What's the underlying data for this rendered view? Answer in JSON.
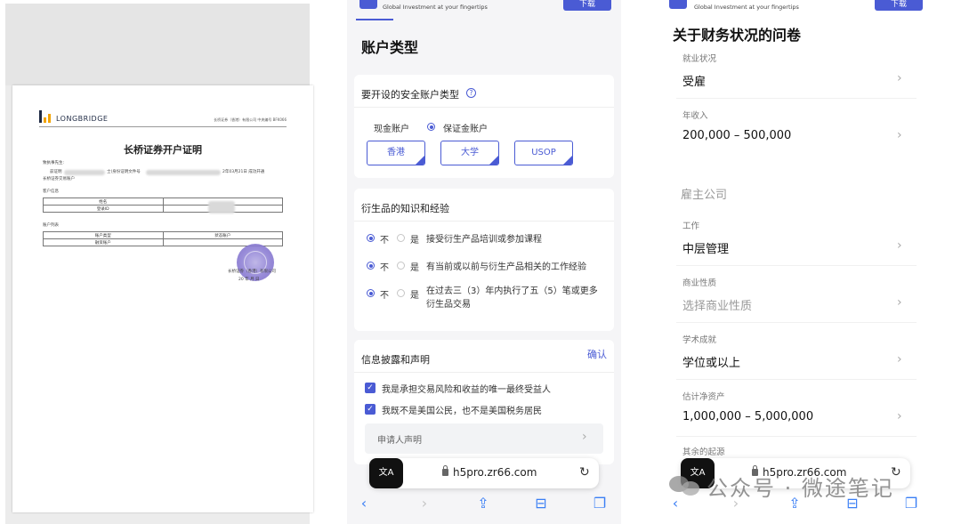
{
  "document": {
    "brand": "LONGBRIDGE",
    "header_right": "长桥证券（香港）有限公司 中央编号 BFK066",
    "title": "长桥证券开户证明",
    "salutation": "致执事先生:",
    "body_line1": "兹证明",
    "body_mid": "士(身份证明文件号",
    "body_tail": "2年03月21日 成功开通",
    "body_line2": "长桥证券交易账户",
    "section_client": "客户信息",
    "table1": [
      [
        "姓名",
        ""
      ],
      [
        "登录ID",
        ""
      ]
    ],
    "section_account": "账户列表",
    "table2": [
      [
        "账户类型",
        "状态账户"
      ],
      [
        "融资账户",
        ""
      ]
    ],
    "footer_company": "长桥证券（香港）有限公司",
    "footer_date": "20 年 月 日"
  },
  "middle": {
    "header_sub": "Global Investment at your fingertips",
    "download_label": "下载",
    "page_title": "账户类型",
    "account_card": {
      "title": "要开设的安全账户类型",
      "help": "?",
      "cash_label": "现金账户",
      "margin_label": "保证金账户",
      "options": [
        "香港",
        "大学",
        "USOP"
      ]
    },
    "deriv_card": {
      "title": "衍生品的知识和经验",
      "no": "不",
      "yes": "是",
      "q1": "接受衍生产品培训或参加课程",
      "q2": "有当前或以前与衍生产品相关的工作经验",
      "q3": "在过去三（3）年内执行了五（5）笔或更多衍生品交易"
    },
    "disclosure_card": {
      "title": "信息披露和声明",
      "confirm": "确认",
      "c1": "我是承担交易风险和收益的唯一最终受益人",
      "c2": "我既不是美国公民，也不是美国税务居民",
      "applicant": "申请人声明"
    },
    "url": "h5pro.zr66.com"
  },
  "right": {
    "header_sub": "Global Investment at your fingertips",
    "download_label": "下载",
    "title": "关于财务状况的问卷",
    "employment_label": "就业状况",
    "employment_value": "受雇",
    "income_label": "年收入",
    "income_value": "200,000 – 500,000",
    "employer_section": "雇主公司",
    "job_label": "工作",
    "job_value": "中层管理",
    "business_label": "商业性质",
    "business_placeholder": "选择商业性质",
    "education_label": "学术成就",
    "education_value": "学位或以上",
    "networth_label": "估计净资产",
    "networth_value": "1,000,000 – 5,000,000",
    "funds_label": "其余的起源",
    "url": "h5pro.zr66.com"
  },
  "watermark": "公众号 · 微途笔记",
  "colors": {
    "accent": "#4a5bd4",
    "safari_blue": "#3b7ff5"
  }
}
